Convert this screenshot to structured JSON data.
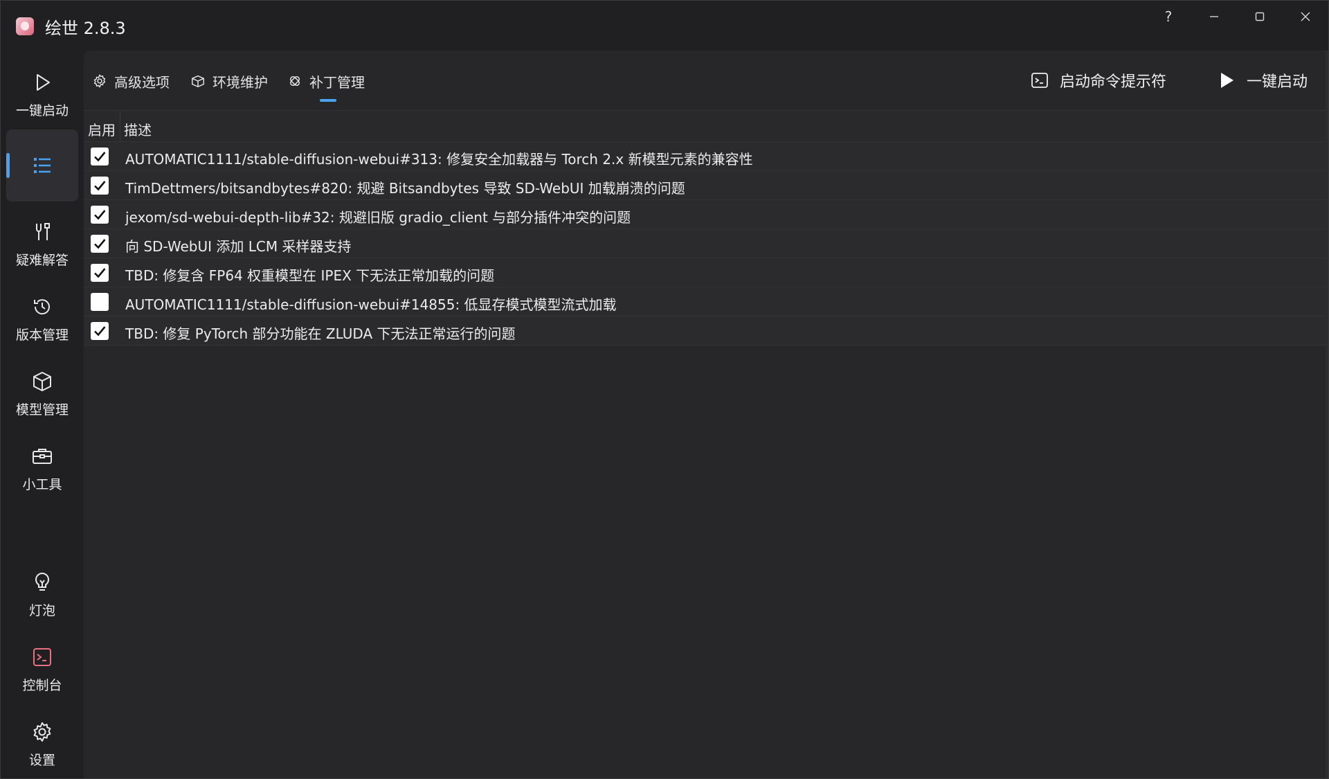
{
  "app": {
    "title": "绘世 2.8.3",
    "help_glyph": "?",
    "controls": [
      "minimize-icon",
      "maximize-icon",
      "close-icon"
    ]
  },
  "sidebar": {
    "items": [
      {
        "label": "一键启动",
        "icon": "play-icon"
      },
      {
        "label": "",
        "icon": "list-icon",
        "active": true
      },
      {
        "label": "疑难解答",
        "icon": "tools-icon"
      },
      {
        "label": "版本管理",
        "icon": "history-icon"
      },
      {
        "label": "模型管理",
        "icon": "cube-icon"
      },
      {
        "label": "小工具",
        "icon": "toolbox-icon"
      },
      {
        "label": "灯泡",
        "icon": "lightbulb-icon"
      },
      {
        "label": "控制台",
        "icon": "console-icon"
      },
      {
        "label": "设置",
        "icon": "gear-icon"
      }
    ]
  },
  "toolbar": {
    "tabs": [
      {
        "label": "高级选项",
        "icon": "gear-icon"
      },
      {
        "label": "环境维护",
        "icon": "package-icon"
      },
      {
        "label": "补丁管理",
        "icon": "patch-icon",
        "active": true
      }
    ],
    "cmd_button": "启动命令提示符",
    "launch_button": "一键启动"
  },
  "table": {
    "headers": {
      "enable": "启用",
      "desc": "描述"
    },
    "rows": [
      {
        "checked": true,
        "text": "AUTOMATIC1111/stable-diffusion-webui#313: 修复安全加载器与 Torch 2.x 新模型元素的兼容性"
      },
      {
        "checked": true,
        "text": "TimDettmers/bitsandbytes#820: 规避 Bitsandbytes 导致 SD-WebUI 加载崩溃的问题"
      },
      {
        "checked": true,
        "text": "jexom/sd-webui-depth-lib#32: 规避旧版 gradio_client 与部分插件冲突的问题"
      },
      {
        "checked": true,
        "text": "向 SD-WebUI 添加 LCM 采样器支持"
      },
      {
        "checked": true,
        "text": "TBD: 修复含 FP64 权重模型在 IPEX 下无法正常加载的问题"
      },
      {
        "checked": false,
        "text": "AUTOMATIC1111/stable-diffusion-webui#14855: 低显存模式模型流式加载"
      },
      {
        "checked": true,
        "text": "TBD: 修复 PyTorch 部分功能在 ZLUDA 下无法正常运行的问题"
      }
    ]
  },
  "colors": {
    "accent": "#4aa3f0",
    "console_icon": "#e9707f",
    "bg": "#202022",
    "panel": "#272729"
  }
}
